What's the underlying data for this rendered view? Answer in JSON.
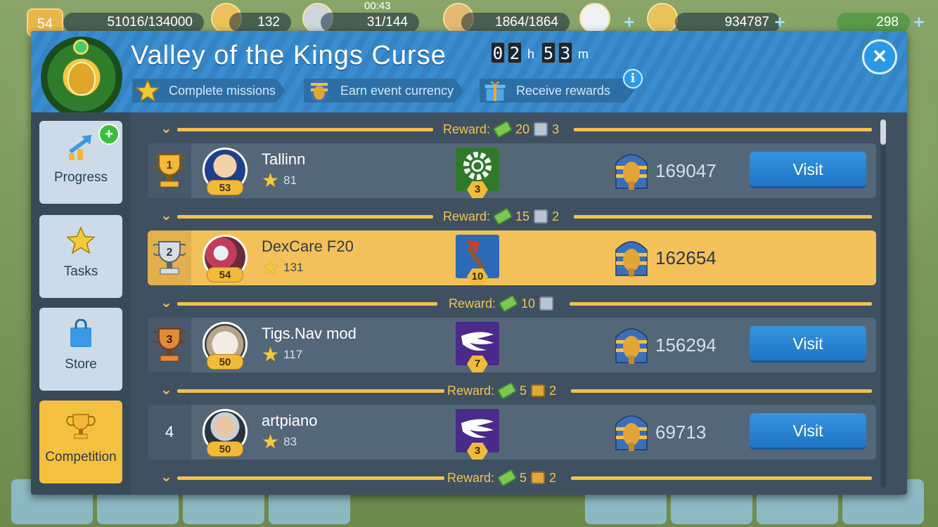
{
  "hud": {
    "level": "54",
    "xp": "51016/134000",
    "stars": "132",
    "timer": "00:43",
    "fuel": "31/144",
    "cargo": "1864/1864",
    "coins": "934787",
    "cash": "298"
  },
  "header": {
    "title": "Valley of the Kings Curse",
    "countdown": {
      "h1": "0",
      "h2": "2",
      "h_unit": "h",
      "m1": "5",
      "m2": "3",
      "m_unit": "m"
    },
    "close_label": "×",
    "info_label": "i",
    "steps": [
      {
        "label": "Complete missions",
        "icon": "star-icon"
      },
      {
        "label": "Earn event currency",
        "icon": "pharaoh-icon"
      },
      {
        "label": "Receive rewards",
        "icon": "gift-icon"
      }
    ]
  },
  "sidebar": {
    "items": [
      {
        "label": "Progress",
        "icon": "progress-arrow-icon",
        "active": false
      },
      {
        "label": "Tasks",
        "icon": "star-icon",
        "active": false
      },
      {
        "label": "Store",
        "icon": "shopping-bag-icon",
        "active": false
      },
      {
        "label": "Competition",
        "icon": "trophy-icon",
        "active": true
      }
    ]
  },
  "rewards": [
    {
      "label": "Reward:",
      "cash": "20",
      "second": "3",
      "second_icon": "gift-icon"
    },
    {
      "label": "Reward:",
      "cash": "15",
      "second": "2",
      "second_icon": "gift-icon"
    },
    {
      "label": "Reward:",
      "cash": "10",
      "second": "",
      "second_icon": "gift-icon"
    },
    {
      "label": "Reward:",
      "cash": "5",
      "second": "2",
      "second_icon": "chest-icon"
    },
    {
      "label": "Reward:",
      "cash": "5",
      "second": "2",
      "second_icon": "chest-icon"
    }
  ],
  "entries": [
    {
      "rank": "1",
      "name": "Tallinn",
      "level": "53",
      "stars": "81",
      "emblem_level": "3",
      "score": "169047",
      "visit": "Visit",
      "me": false
    },
    {
      "rank": "2",
      "name": "DexCare F20",
      "level": "54",
      "stars": "131",
      "emblem_level": "10",
      "score": "162654",
      "visit": "",
      "me": true
    },
    {
      "rank": "3",
      "name": "Tigs.Nav mod",
      "level": "50",
      "stars": "117",
      "emblem_level": "7",
      "score": "156294",
      "visit": "Visit",
      "me": false
    },
    {
      "rank": "4",
      "name": "artpiano",
      "level": "50",
      "stars": "83",
      "emblem_level": "3",
      "score": "69713",
      "visit": "Visit",
      "me": false
    }
  ],
  "colors": {
    "accent_gold": "#f1c14c",
    "visit_blue": "#2a86d4",
    "header_blue": "#3a8ed0",
    "panel_dark": "#3f5161"
  }
}
